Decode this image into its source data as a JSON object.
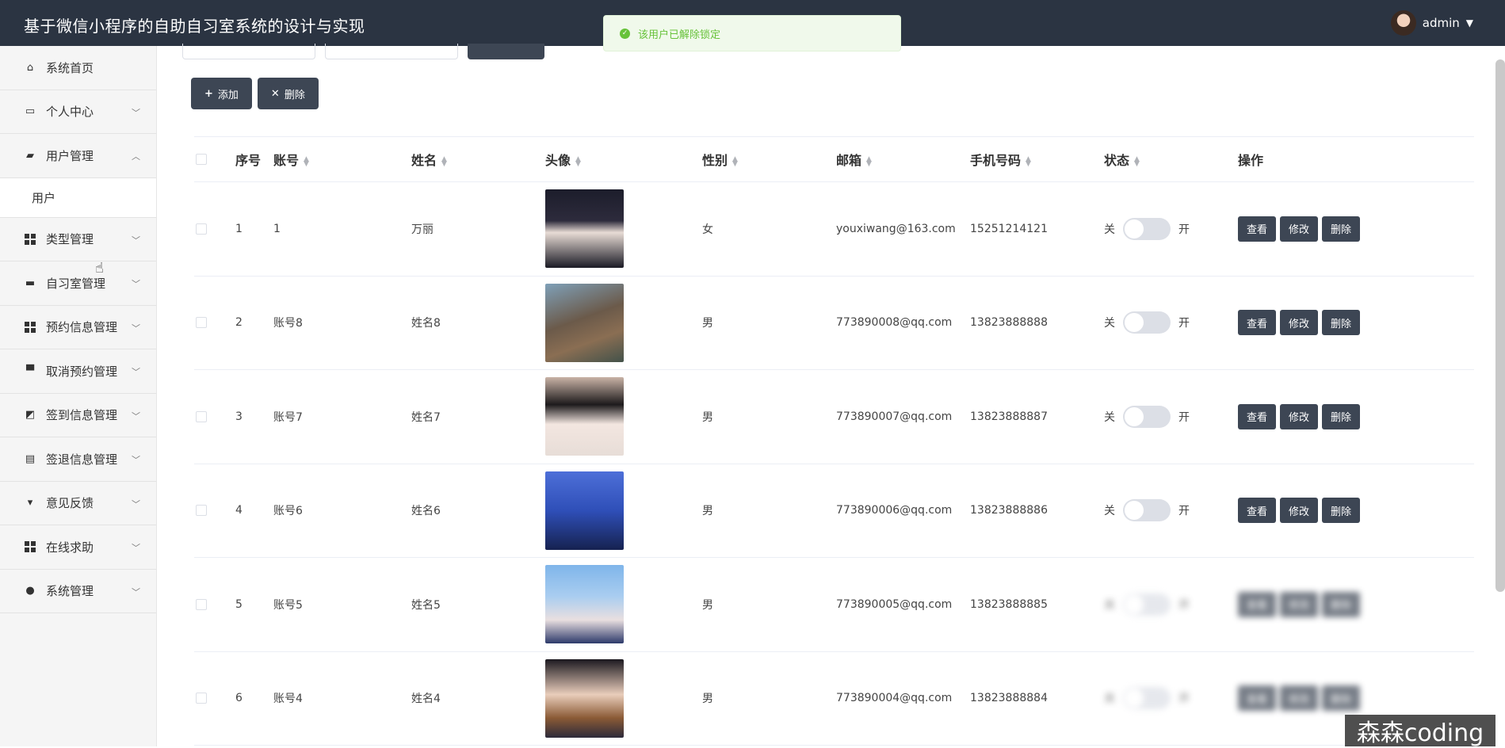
{
  "app": {
    "title": "基于微信小程序的自助自习室系统的设计与实现",
    "user": "admin"
  },
  "toast": {
    "message": "该用户已解除锁定"
  },
  "sidebar": {
    "items": [
      {
        "label": "系统首页",
        "icon": "home-icon",
        "chevron": false
      },
      {
        "label": "个人中心",
        "icon": "profile-icon",
        "chevron": true
      },
      {
        "label": "用户管理",
        "icon": "users-icon",
        "chevron": true,
        "expanded": true
      },
      {
        "label": "类型管理",
        "icon": "grid-icon",
        "chevron": true
      },
      {
        "label": "自习室管理",
        "icon": "briefcase-icon",
        "chevron": true
      },
      {
        "label": "预约信息管理",
        "icon": "grid-icon",
        "chevron": true
      },
      {
        "label": "取消预约管理",
        "icon": "printer-icon",
        "chevron": true
      },
      {
        "label": "签到信息管理",
        "icon": "chart-icon",
        "chevron": true
      },
      {
        "label": "签退信息管理",
        "icon": "clipboard-icon",
        "chevron": true
      },
      {
        "label": "意见反馈",
        "icon": "sign-icon",
        "chevron": true
      },
      {
        "label": "在线求助",
        "icon": "grid-icon",
        "chevron": true
      },
      {
        "label": "系统管理",
        "icon": "bulb-icon",
        "chevron": true
      }
    ],
    "sub_item": "用户"
  },
  "toolbar": {
    "add_label": "添加",
    "delete_label": "删除"
  },
  "table": {
    "headers": {
      "index": "序号",
      "account": "账号",
      "name": "姓名",
      "avatar": "头像",
      "gender": "性别",
      "email": "邮箱",
      "phone": "手机号码",
      "status": "状态",
      "ops": "操作"
    },
    "rows": [
      {
        "index": "1",
        "account": "1",
        "name": "万丽",
        "gender": "女",
        "email": "youxiwang@163.com",
        "phone": "15251214121"
      },
      {
        "index": "2",
        "account": "账号8",
        "name": "姓名8",
        "gender": "男",
        "email": "773890008@qq.com",
        "phone": "13823888888"
      },
      {
        "index": "3",
        "account": "账号7",
        "name": "姓名7",
        "gender": "男",
        "email": "773890007@qq.com",
        "phone": "13823888887"
      },
      {
        "index": "4",
        "account": "账号6",
        "name": "姓名6",
        "gender": "男",
        "email": "773890006@qq.com",
        "phone": "13823888886"
      },
      {
        "index": "5",
        "account": "账号5",
        "name": "姓名5",
        "gender": "男",
        "email": "773890005@qq.com",
        "phone": "13823888885"
      },
      {
        "index": "6",
        "account": "账号4",
        "name": "姓名4",
        "gender": "男",
        "email": "773890004@qq.com",
        "phone": "13823888884"
      }
    ],
    "switch_off": "关",
    "switch_on": "开",
    "btn_view": "查看",
    "btn_edit": "修改",
    "btn_delete": "删除"
  },
  "watermark": "森森coding"
}
